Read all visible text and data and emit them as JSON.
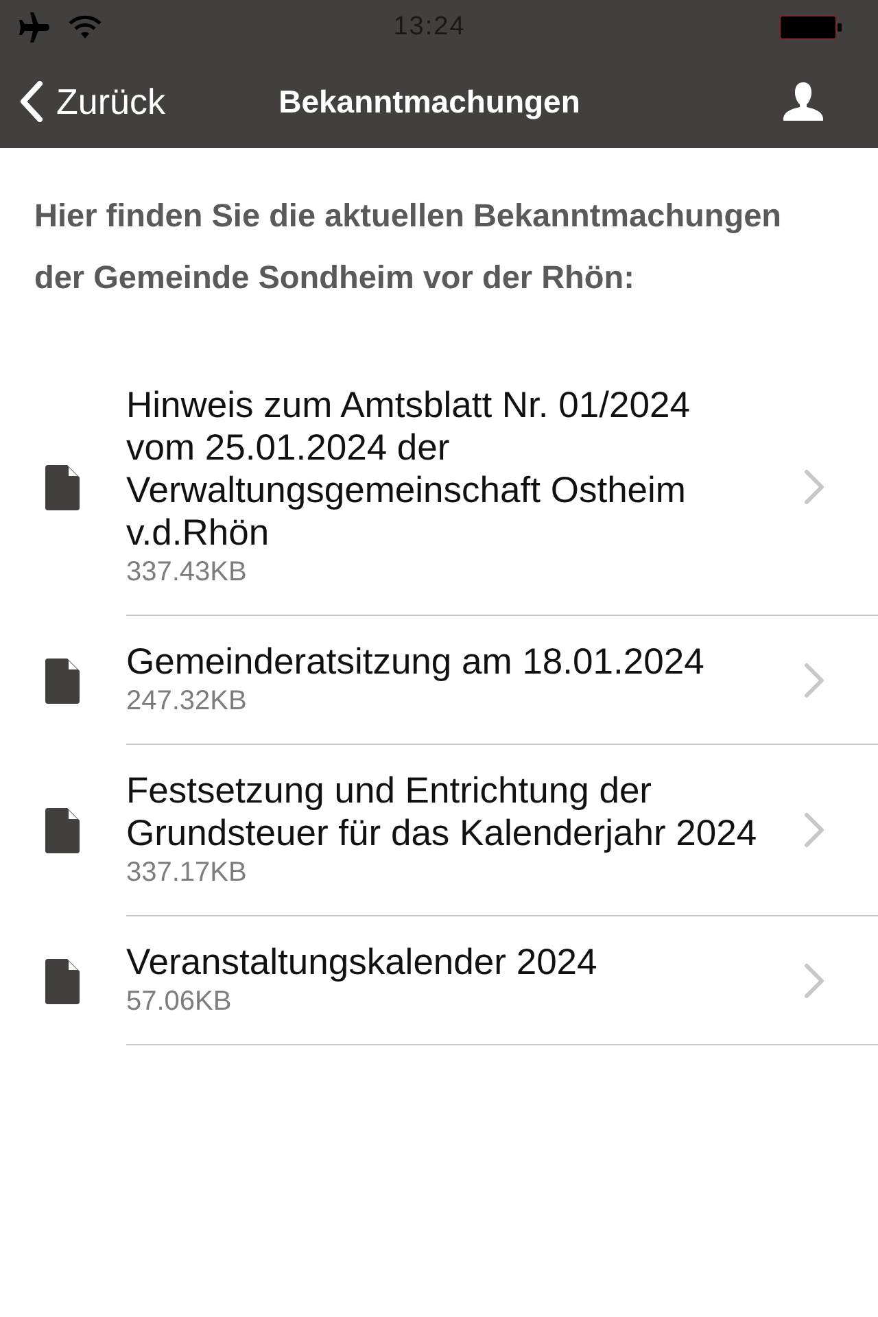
{
  "status_bar": {
    "time": "13:24"
  },
  "nav_bar": {
    "back_label": "Zurück",
    "title": "Bekanntmachungen"
  },
  "intro": "Hier finden Sie die aktuellen Bekanntmachungen der Gemeinde Sondheim vor der Rhön:",
  "documents": [
    {
      "title": "Hinweis zum Amtsblatt Nr. 01/2024 vom 25.01.2024 der Verwaltungsgemeinschaft Ostheim v.d.Rhön",
      "size": "337.43KB"
    },
    {
      "title": "Gemeinderatsitzung am 18.01.2024",
      "size": "247.32KB"
    },
    {
      "title": "Festsetzung und Entrichtung der Grundsteuer für das Kalenderjahr 2024",
      "size": "337.17KB"
    },
    {
      "title": "Veranstaltungskalender 2024",
      "size": "57.06KB"
    }
  ]
}
